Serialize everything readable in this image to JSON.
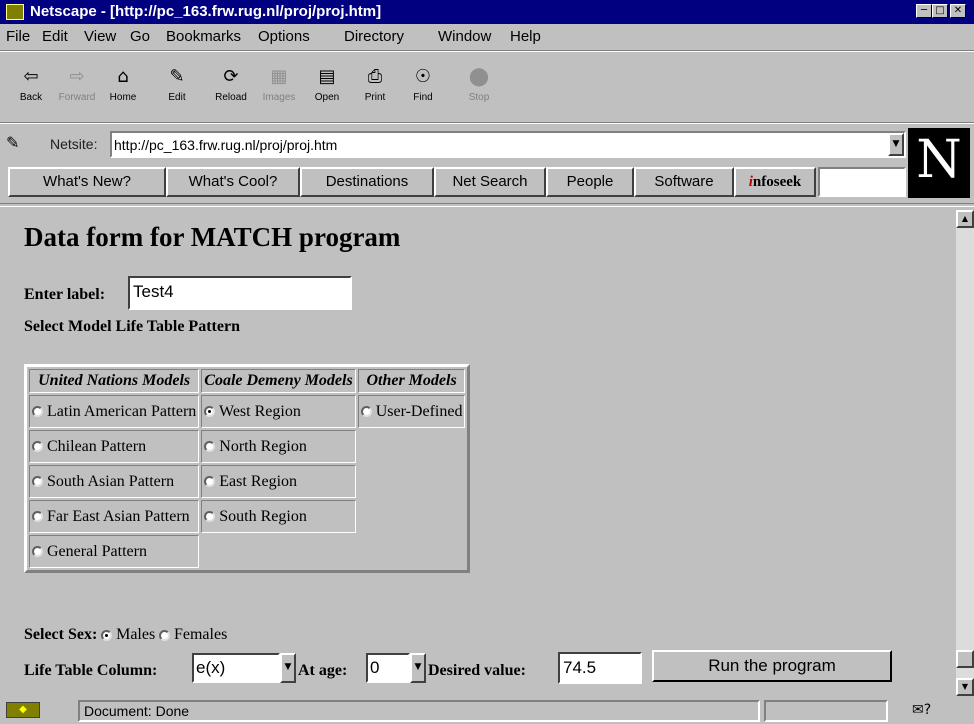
{
  "window": {
    "title": "Netscape - [http://pc_163.frw.rug.nl/proj/proj.htm]"
  },
  "menu": [
    "File",
    "Edit",
    "View",
    "Go",
    "Bookmarks",
    "Options",
    "Directory",
    "Window",
    "Help"
  ],
  "toolbar": [
    {
      "label": "Back",
      "icon": "back-arrow-icon",
      "enabled": true
    },
    {
      "label": "Forward",
      "icon": "forward-arrow-icon",
      "enabled": false
    },
    {
      "label": "Home",
      "icon": "home-icon",
      "enabled": true
    },
    {
      "label": "Edit",
      "icon": "pencil-icon",
      "enabled": true
    },
    {
      "label": "Reload",
      "icon": "reload-icon",
      "enabled": true
    },
    {
      "label": "Images",
      "icon": "images-icon",
      "enabled": false
    },
    {
      "label": "Open",
      "icon": "open-icon",
      "enabled": true
    },
    {
      "label": "Print",
      "icon": "printer-icon",
      "enabled": true
    },
    {
      "label": "Find",
      "icon": "binoculars-icon",
      "enabled": true
    },
    {
      "label": "Stop",
      "icon": "stop-icon",
      "enabled": false
    }
  ],
  "location": {
    "label": "Netsite:",
    "url": "http://pc_163.frw.rug.nl/proj/proj.htm"
  },
  "directory_buttons": [
    "What's New?",
    "What's Cool?",
    "Destinations",
    "Net Search",
    "People",
    "Software",
    "infoseek"
  ],
  "infoseek": {
    "i": "i",
    "rest": "nfoseek"
  },
  "logo": "N",
  "page": {
    "heading": "Data form for MATCH program",
    "label_prompt": "Enter label:",
    "label_value": "Test4",
    "model_prompt": "Select Model Life Table Pattern",
    "columns": [
      "United Nations Models",
      "Coale Demeny Models",
      "Other Models"
    ],
    "un_models": [
      {
        "label": "Latin American Pattern",
        "checked": false
      },
      {
        "label": "Chilean Pattern",
        "checked": false
      },
      {
        "label": "South Asian Pattern",
        "checked": false
      },
      {
        "label": "Far East Asian Pattern",
        "checked": false
      },
      {
        "label": "General Pattern",
        "checked": false
      }
    ],
    "cd_models": [
      {
        "label": "West Region",
        "checked": true
      },
      {
        "label": "North Region",
        "checked": false
      },
      {
        "label": "East Region",
        "checked": false
      },
      {
        "label": "South Region",
        "checked": false
      }
    ],
    "other_models": [
      {
        "label": "User-Defined",
        "checked": false
      }
    ],
    "sex_prompt": "Select Sex:",
    "sex_options": [
      {
        "label": "Males",
        "checked": true
      },
      {
        "label": "Females",
        "checked": false
      }
    ],
    "column_prompt": "Life Table Column:",
    "column_value": "e(x)",
    "age_prompt": "At age:",
    "age_value": "0",
    "desired_prompt": "Desired value:",
    "desired_value": "74.5",
    "run_button": "Run the program"
  },
  "status": {
    "text": "Document: Done"
  }
}
